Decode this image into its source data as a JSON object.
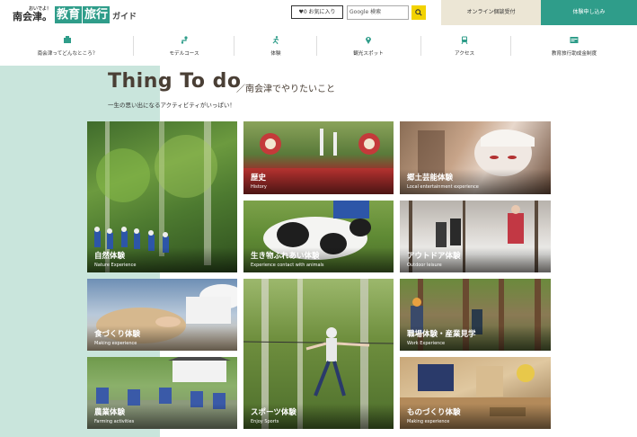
{
  "header": {
    "logo_small": "おいでよ！",
    "logo_main": "南会津。",
    "logo_box1": "教育",
    "logo_box2": "旅行",
    "logo_guide": "ガイド",
    "favorites_label": "♥0 お気に入り",
    "search_placeholder": "Google 検索",
    "online_label": "オンライン個談受付",
    "apply_label": "体験申し込み"
  },
  "nav": {
    "items": [
      {
        "label": "南会津ってどんなところ？",
        "icon": "map-icon"
      },
      {
        "label": "モデルコース",
        "icon": "route-icon"
      },
      {
        "label": "体験",
        "icon": "running-person-icon"
      },
      {
        "label": "観光スポット",
        "icon": "location-pin-icon"
      },
      {
        "label": "アクセス",
        "icon": "train-icon"
      },
      {
        "label": "教育旅行助成金制度",
        "icon": "money-icon"
      }
    ]
  },
  "main": {
    "title": "Thing To do",
    "subtitle": "／南会津でやりたいこと",
    "tagline": "一生の思い出になるアクティビティがいっぱい！"
  },
  "tiles": [
    {
      "jp": "自然体験",
      "en": "Nature Experience"
    },
    {
      "jp": "歴史",
      "en": "History"
    },
    {
      "jp": "郷土芸能体験",
      "en": "Local entertainment experience"
    },
    {
      "jp": "生き物ふれあい体験",
      "en": "Experience contact with animals"
    },
    {
      "jp": "アウトドア体験",
      "en": "Outdoor leisure"
    },
    {
      "jp": "食づくり体験",
      "en": "Making experience"
    },
    {
      "jp": "スポーツ体験",
      "en": "Enjoy Sports"
    },
    {
      "jp": "職場体験・産業見学",
      "en": "Work Experience"
    },
    {
      "jp": "農業体験",
      "en": "Farming activities"
    },
    {
      "jp": "ものづくり体験",
      "en": "Making experience"
    }
  ],
  "colors": {
    "accent": "#2f9d8a",
    "mint": "#c9e5dc",
    "title_brown": "#4a3f35",
    "search_yellow": "#f2d200"
  }
}
